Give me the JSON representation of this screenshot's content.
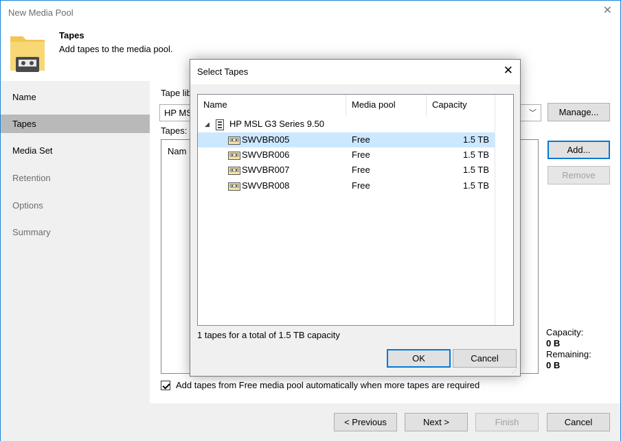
{
  "window": {
    "title": "New Media Pool",
    "close_glyph": "✕"
  },
  "header": {
    "title": "Tapes",
    "subtitle": "Add tapes to the media pool.",
    "icon": "folder-tape-icon"
  },
  "sidebar": {
    "items": [
      {
        "label": "Name",
        "state": "normal"
      },
      {
        "label": "Tapes",
        "state": "active"
      },
      {
        "label": "Media Set",
        "state": "normal"
      },
      {
        "label": "Retention",
        "state": "dim"
      },
      {
        "label": "Options",
        "state": "dim"
      },
      {
        "label": "Summary",
        "state": "dim"
      }
    ]
  },
  "main": {
    "library_label": "Tape lib",
    "library_value": "HP MS",
    "tapes_label": "Tapes:",
    "list_col_name": "Nam",
    "manage_label": "Manage...",
    "add_label": "Add...",
    "remove_label": "Remove",
    "capacity_label": "Capacity:",
    "capacity_value": "0 B",
    "remaining_label": "Remaining:",
    "remaining_value": "0 B",
    "auto_add_label": "Add tapes from Free media pool automatically when more tapes are required",
    "auto_add_checked": true
  },
  "footer": {
    "previous_label": "< Previous",
    "next_label": "Next >",
    "finish_label": "Finish",
    "cancel_label": "Cancel"
  },
  "dialog": {
    "title": "Select Tapes",
    "close_glyph": "✕",
    "columns": [
      "Name",
      "Media pool",
      "Capacity"
    ],
    "library": {
      "expander": "◢",
      "name": "HP MSL G3 Series 9.50"
    },
    "tapes": [
      {
        "name": "SWVBR005",
        "pool": "Free",
        "capacity": "1.5 TB",
        "selected": true
      },
      {
        "name": "SWVBR006",
        "pool": "Free",
        "capacity": "1.5 TB",
        "selected": false
      },
      {
        "name": "SWVBR007",
        "pool": "Free",
        "capacity": "1.5 TB",
        "selected": false
      },
      {
        "name": "SWVBR008",
        "pool": "Free",
        "capacity": "1.5 TB",
        "selected": false
      }
    ],
    "summary": "1 tapes for a total of 1.5 TB capacity",
    "ok_label": "OK",
    "cancel_label": "Cancel"
  },
  "colors": {
    "accent": "#0078d7",
    "selection": "#cce8ff",
    "sidebar_active": "#b9b9b9",
    "panel": "#f0f0f0"
  }
}
